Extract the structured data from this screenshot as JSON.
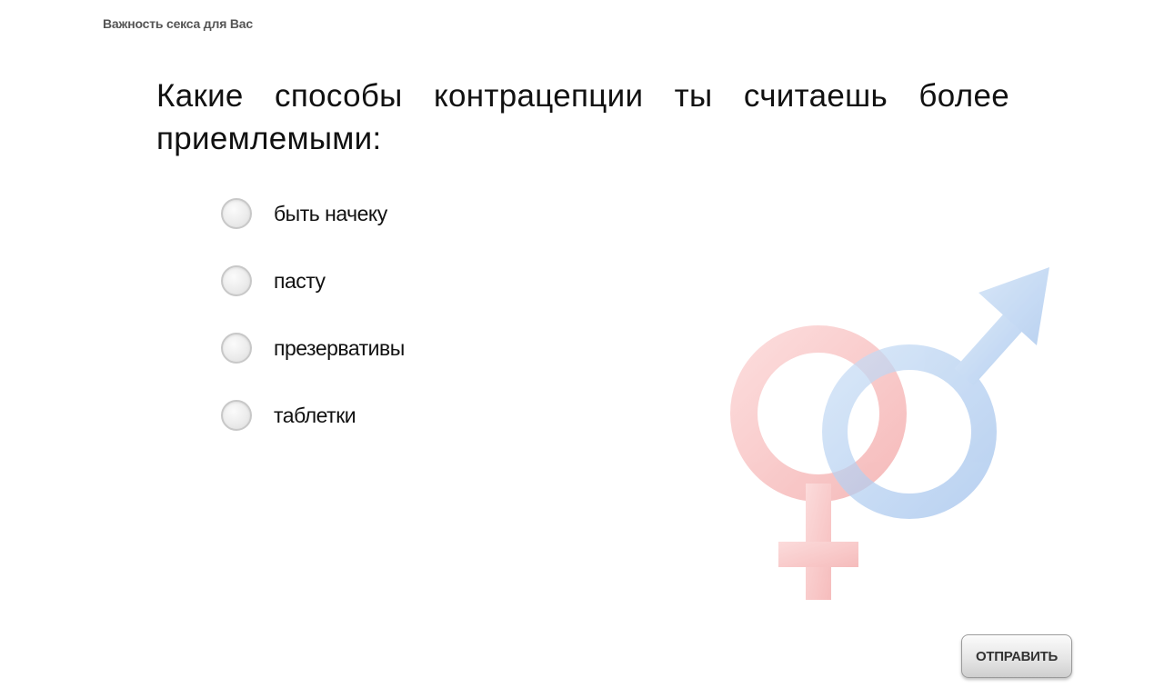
{
  "header": {
    "title": "Важность секса для Вас"
  },
  "question": {
    "text": "Какие способы контрацепции ты считаешь более приемлемыми:"
  },
  "options": [
    {
      "label": "быть начеку",
      "selected": false
    },
    {
      "label": "пасту",
      "selected": false
    },
    {
      "label": "презервативы",
      "selected": false
    },
    {
      "label": "таблетки",
      "selected": false
    }
  ],
  "decoration": {
    "icon": "gender-symbols-icon",
    "female_color": "#f4a5a5",
    "male_color": "#a9c8ee"
  },
  "actions": {
    "submit_label": "ОТПРАВИТЬ"
  }
}
